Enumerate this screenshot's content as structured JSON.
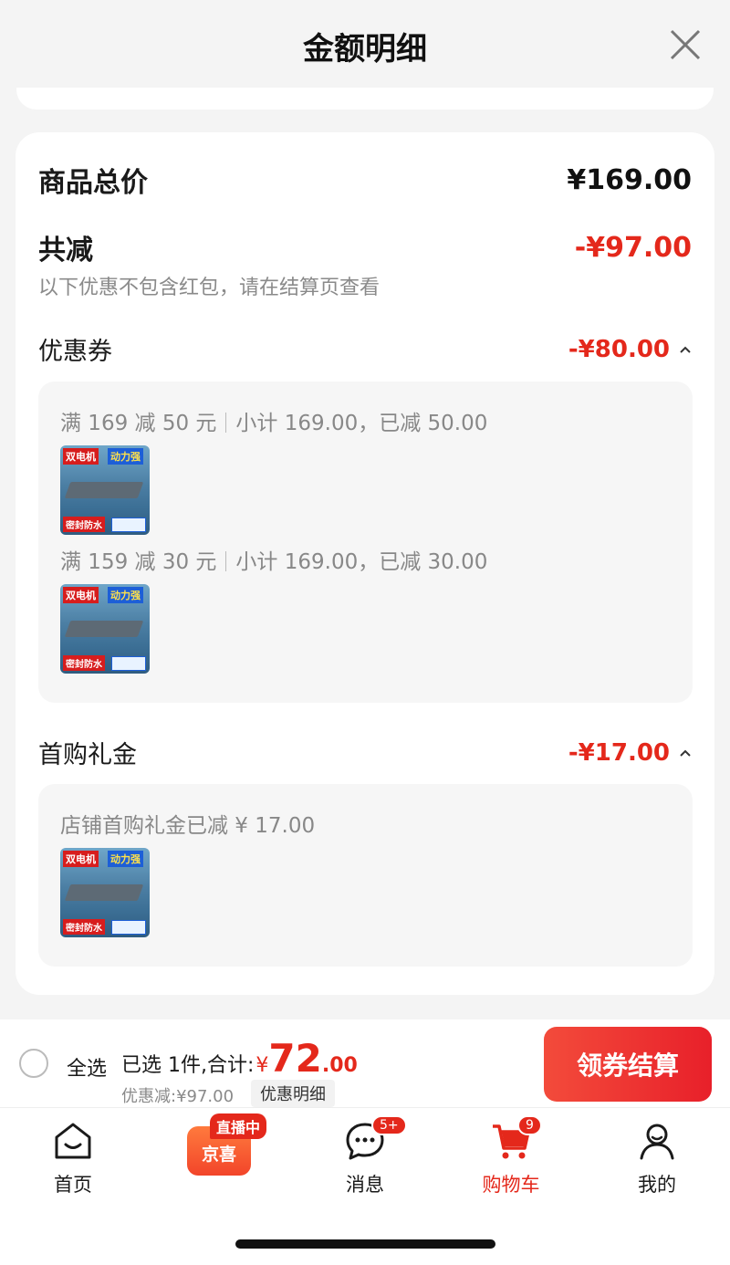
{
  "header": {
    "title": "金额明细"
  },
  "summary": {
    "total_label": "商品总价",
    "total_value": "¥169.00",
    "reduce_label": "共减",
    "reduce_value": "-¥97.00",
    "note": "以下优惠不包含红包，请在结算页查看"
  },
  "coupon": {
    "label": "优惠券",
    "value": "-¥80.00",
    "rules": [
      {
        "condition": "满 169 减 50 元",
        "detail": "小计 169.00，已减 50.00"
      },
      {
        "condition": "满 159 减 30 元",
        "detail": "小计 169.00，已减 30.00"
      }
    ]
  },
  "first_buy": {
    "label": "首购礼金",
    "value": "-¥17.00",
    "detail": "店铺首购礼金已减 ¥ 17.00"
  },
  "product_thumb": {
    "tag_motor": "双电机",
    "tag_power": "动力强",
    "tag_waterproof": "密封防水"
  },
  "bottom_bar": {
    "select_all": "全选",
    "selected_text": "已选 1件,合计:",
    "currency": "¥",
    "total_int": "72",
    "total_dec": ".00",
    "discount_text": "优惠减:¥97.00",
    "discount_detail": "优惠明细",
    "checkout": "领券结算"
  },
  "tabbar": {
    "home": "首页",
    "live_badge": "直播中",
    "jingxi": "京喜",
    "messages": "消息",
    "messages_badge": "5+",
    "cart": "购物车",
    "cart_badge": "9",
    "mine": "我的"
  },
  "colors": {
    "accent": "#e4281b",
    "button": "#e8202a"
  }
}
